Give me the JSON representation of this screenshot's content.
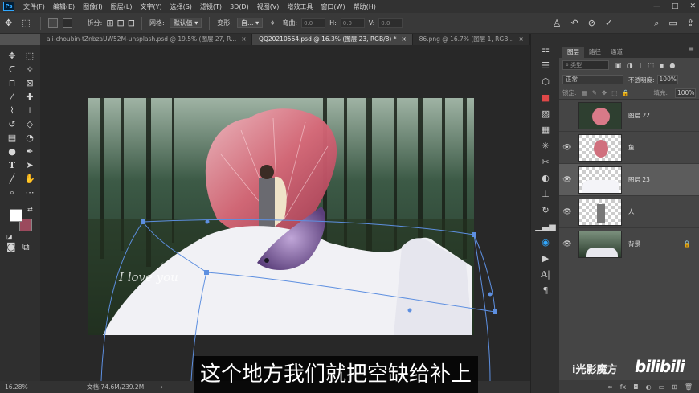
{
  "app": {
    "logo": "Ps"
  },
  "menubar": {
    "items": [
      "文件(F)",
      "编辑(E)",
      "图像(I)",
      "图层(L)",
      "文字(Y)",
      "选择(S)",
      "滤镜(T)",
      "3D(D)",
      "视图(V)",
      "增效工具",
      "窗口(W)",
      "帮助(H)"
    ],
    "minimize": "—",
    "maximize": "□",
    "close": "✕"
  },
  "options": {
    "split_label": "拆分:",
    "grid_label": "网格:",
    "grid_value": "默认值",
    "transform_label": "变形:",
    "transform_value": "自...",
    "h_label": "弯曲:",
    "h_value": "0.0",
    "hh_label": "H:",
    "hh_value": "0.0",
    "v_label": "V:",
    "v_value": "0.0"
  },
  "tabs": [
    {
      "label": "ali-choubin-tZnbzaUW52M-unsplash.psd @ 19.5% (图层 27, R...",
      "close": "×"
    },
    {
      "label": "QQ20210564.psd @ 16.3% (图层 23, RGB/8) *",
      "close": "×"
    },
    {
      "label": "86.png @ 16.7% (图层 1, RGB...",
      "close": "×"
    }
  ],
  "canvas": {
    "signature_text": "I love you"
  },
  "statusbar": {
    "zoom": "16.28%",
    "doc": "文档:74.6M/239.2M"
  },
  "layers_panel": {
    "tabs": [
      "图层",
      "路径",
      "通道"
    ],
    "filter_placeholder": "类型",
    "blend_mode": "正常",
    "opacity_label": "不透明度:",
    "opacity_value": "100%",
    "lock_label": "锁定:",
    "fill_label": "填充:",
    "fill_value": "100%",
    "layers": [
      {
        "name": "图层 22",
        "visible": false,
        "selected": false,
        "locked": false
      },
      {
        "name": "鱼",
        "visible": true,
        "selected": false,
        "locked": false
      },
      {
        "name": "图层 23",
        "visible": true,
        "selected": true,
        "locked": false
      },
      {
        "name": "人",
        "visible": true,
        "selected": false,
        "locked": false
      },
      {
        "name": "背景",
        "visible": true,
        "selected": false,
        "locked": true
      }
    ]
  },
  "overlay": {
    "subtitle": "这个地方我们就把空缺给补上",
    "watermark": "i光影魔方",
    "bili": "bilibili"
  },
  "colors": {
    "foreground": "#ffffff",
    "background": "#9b4a5d",
    "accent": "#31a8ff"
  }
}
